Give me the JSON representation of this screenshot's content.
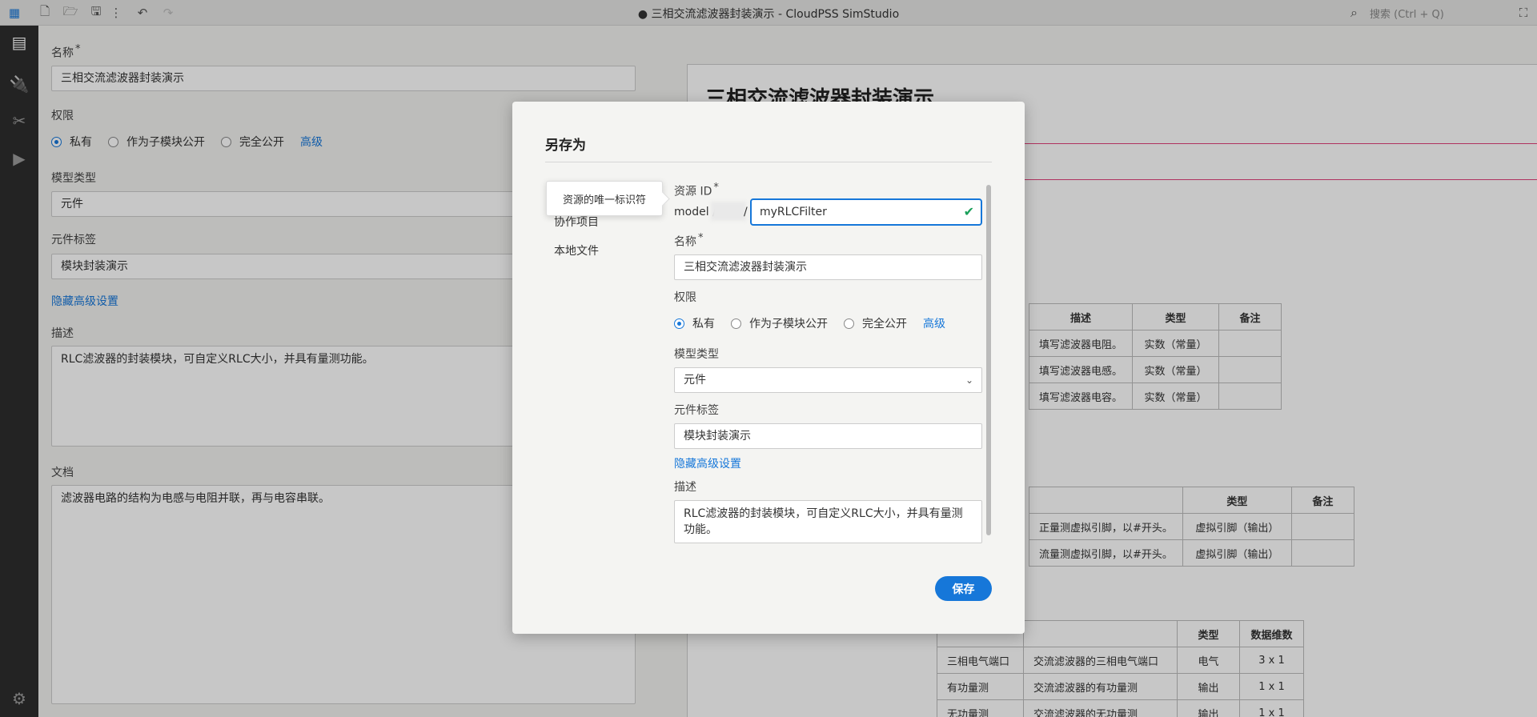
{
  "window": {
    "title": "● 三相交流滤波器封装演示 - CloudPSS SimStudio",
    "search_placeholder": "搜索 (Ctrl + Q)"
  },
  "activity_bar": {
    "items": [
      "properties-icon",
      "plug-icon",
      "tools-icon",
      "run-icon"
    ],
    "bottom": "gear-icon"
  },
  "form": {
    "name_label": "名称",
    "name_value": "三相交流滤波器封装演示",
    "permission_label": "权限",
    "permissions": [
      "私有",
      "作为子模块公开",
      "完全公开"
    ],
    "advanced_link": "高级",
    "model_type_label": "模型类型",
    "model_type_value": "元件",
    "tag_label": "元件标签",
    "tag_value": "模块封装演示",
    "hide_advanced_link": "隐藏高级设置",
    "desc_label": "描述",
    "desc_value": "RLC滤波器的封装模块，可自定义RLC大小，并具有量测功能。",
    "doc_label": "文档",
    "doc_value": "滤波器电路的结构为电感与电阻并联，再与电容串联。"
  },
  "doc": {
    "title": "三相交流滤波器封装演示",
    "table1": {
      "headers": [
        "描述",
        "类型",
        "备注"
      ],
      "rows": [
        [
          "填写滤波器电阻。",
          "实数（常量）",
          ""
        ],
        [
          "填写滤波器电感。",
          "实数（常量）",
          ""
        ],
        [
          "填写滤波器电容。",
          "实数（常量）",
          ""
        ]
      ]
    },
    "table2": {
      "headers": [
        "",
        "类型",
        "备注"
      ],
      "rows": [
        [
          "正量测虚拟引脚，以#开头。",
          "虚拟引脚（输出）",
          ""
        ],
        [
          "流量测虚拟引脚，以#开头。",
          "虚拟引脚（输出）",
          ""
        ]
      ]
    },
    "table3": {
      "headers": [
        "",
        "",
        "类型",
        "数据维数"
      ],
      "rows": [
        [
          "三相电气端口",
          "交流滤波器的三相电气端口",
          "电气",
          "3 x 1"
        ],
        [
          "有功量测",
          "交流滤波器的有功量测",
          "输出",
          "1 x 1"
        ],
        [
          "无功量测",
          "交流滤波器的无功量测",
          "输出",
          "1 x 1"
        ]
      ]
    }
  },
  "dialog": {
    "title": "另存为",
    "side_items": [
      "协作项目",
      "本地文件"
    ],
    "tooltip": "资源的唯一标识符",
    "resource_id_label": "资源 ID",
    "model_prefix": "model /",
    "slash": "/",
    "resource_id_value": "myRLCFilter",
    "name_label": "名称",
    "name_value": "三相交流滤波器封装演示",
    "permission_label": "权限",
    "permissions": [
      "私有",
      "作为子模块公开",
      "完全公开"
    ],
    "advanced_link": "高级",
    "model_type_label": "模型类型",
    "model_type_value": "元件",
    "tag_label": "元件标签",
    "tag_value": "模块封装演示",
    "hide_advanced_link": "隐藏高级设置",
    "desc_label": "描述",
    "desc_value": "RLC滤波器的封装模块，可自定义RLC大小，并具有量测功能。",
    "save_label": "保存"
  },
  "colors": {
    "accent": "#1677d9",
    "success": "#1aa05a",
    "highlight_border": "#e0407a"
  }
}
